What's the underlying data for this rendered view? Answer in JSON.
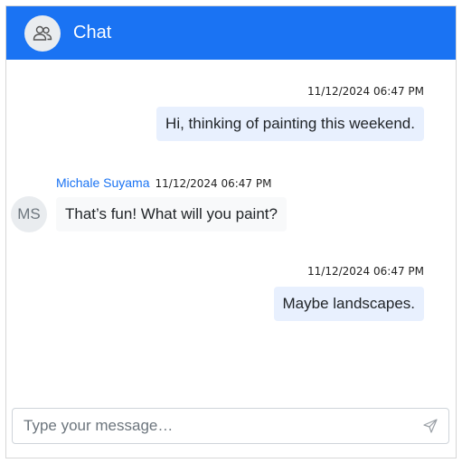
{
  "header": {
    "title": "Chat",
    "avatar_icon": "users-icon",
    "color": "#1a73f3"
  },
  "messages": [
    {
      "direction": "outgoing",
      "timestamp": "11/12/2024 06:47 PM",
      "text": "Hi, thinking of painting this weekend."
    },
    {
      "direction": "incoming",
      "sender": "Michale Suyama",
      "initials": "MS",
      "timestamp": "11/12/2024 06:47 PM",
      "text": "That’s fun! What will you paint?"
    },
    {
      "direction": "outgoing",
      "timestamp": "11/12/2024 06:47 PM",
      "text": "Maybe landscapes."
    }
  ],
  "composer": {
    "placeholder": "Type your message…",
    "value": "",
    "send_icon": "send-icon"
  }
}
